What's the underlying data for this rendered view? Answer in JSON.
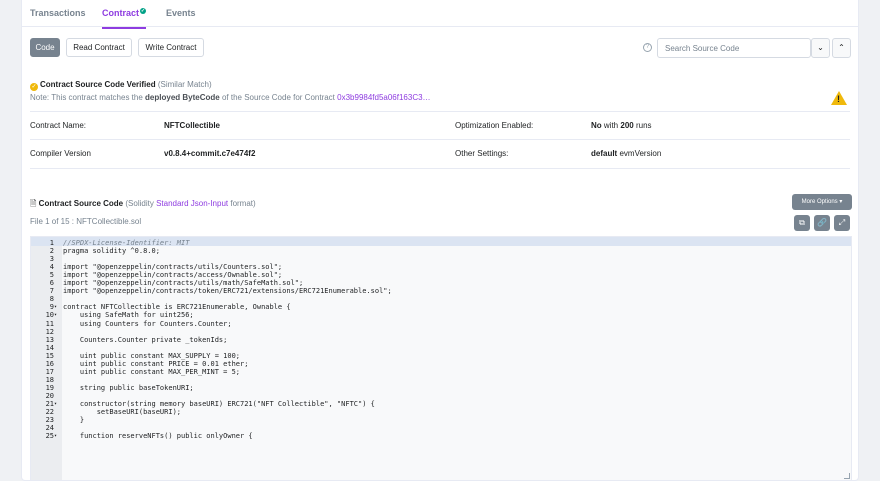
{
  "tabs": [
    {
      "label": "Transactions"
    },
    {
      "label": "Contract"
    },
    {
      "label": "Events"
    }
  ],
  "toolbar": {
    "code_label": "Code",
    "read_label": "Read Contract",
    "write_label": "Write Contract",
    "help_glyph": "?",
    "search_placeholder": "Search Source Code"
  },
  "verification": {
    "title": "Contract Source Code Verified",
    "match": "(Similar Match)",
    "note_prefix": "Note: This contract matches the",
    "note_bold": "deployed ByteCode",
    "note_mid": "of the Source Code for Contract",
    "address": "0x3b9984fd5a06f163C3…"
  },
  "details": {
    "contract_name_label": "Contract Name:",
    "contract_name": "NFTCollectible",
    "compiler_label": "Compiler Version",
    "compiler": "v0.8.4+commit.c7e474f2",
    "optimization_label": "Optimization Enabled:",
    "optimization_bold": "No",
    "optimization_mid": "with",
    "optimization_runs": "200",
    "optimization_suffix": "runs",
    "other_label": "Other Settings:",
    "other_bold": "default",
    "other_rest": "evmVersion"
  },
  "source": {
    "title": "Contract Source Code",
    "fmt_prefix": "(Solidity",
    "fmt_link": "Standard Json-Input",
    "fmt_suffix": "format)",
    "more_options": "More Options",
    "file_label": "File 1 of 15 : NFTCollectible.sol"
  },
  "code_lines": [
    {
      "n": "1",
      "fold": "",
      "t": "//SPDX-License-Identifier: MIT"
    },
    {
      "n": "2",
      "fold": "",
      "t": "pragma solidity ^0.8.0;"
    },
    {
      "n": "3",
      "fold": "",
      "t": ""
    },
    {
      "n": "4",
      "fold": "",
      "t": "import \"@openzeppelin/contracts/utils/Counters.sol\";"
    },
    {
      "n": "5",
      "fold": "",
      "t": "import \"@openzeppelin/contracts/access/Ownable.sol\";"
    },
    {
      "n": "6",
      "fold": "",
      "t": "import \"@openzeppelin/contracts/utils/math/SafeMath.sol\";"
    },
    {
      "n": "7",
      "fold": "",
      "t": "import \"@openzeppelin/contracts/token/ERC721/extensions/ERC721Enumerable.sol\";"
    },
    {
      "n": "8",
      "fold": "",
      "t": ""
    },
    {
      "n": "9",
      "fold": "▾",
      "t": "contract NFTCollectible is ERC721Enumerable, Ownable {"
    },
    {
      "n": "10",
      "fold": "▾",
      "t": "    using SafeMath for uint256;"
    },
    {
      "n": "11",
      "fold": "",
      "t": "    using Counters for Counters.Counter;"
    },
    {
      "n": "12",
      "fold": "",
      "t": ""
    },
    {
      "n": "13",
      "fold": "",
      "t": "    Counters.Counter private _tokenIds;"
    },
    {
      "n": "14",
      "fold": "",
      "t": ""
    },
    {
      "n": "15",
      "fold": "",
      "t": "    uint public constant MAX_SUPPLY = 100;"
    },
    {
      "n": "16",
      "fold": "",
      "t": "    uint public constant PRICE = 0.01 ether;"
    },
    {
      "n": "17",
      "fold": "",
      "t": "    uint public constant MAX_PER_MINT = 5;"
    },
    {
      "n": "18",
      "fold": "",
      "t": ""
    },
    {
      "n": "19",
      "fold": "",
      "t": "    string public baseTokenURI;"
    },
    {
      "n": "20",
      "fold": "",
      "t": ""
    },
    {
      "n": "21",
      "fold": "▾",
      "t": "    constructor(string memory baseURI) ERC721(\"NFT Collectible\", \"NFTC\") {"
    },
    {
      "n": "22",
      "fold": "",
      "t": "        setBaseURI(baseURI);"
    },
    {
      "n": "23",
      "fold": "",
      "t": "    }"
    },
    {
      "n": "24",
      "fold": "",
      "t": ""
    },
    {
      "n": "25",
      "fold": "▾",
      "t": "    function reserveNFTs() public onlyOwner {"
    }
  ],
  "colors": {
    "accent": "#8e3ce0",
    "verified_check": "#f0b90b",
    "warning": "#f0b90b",
    "button_gray": "#77838f"
  },
  "icons": {
    "contract_verified": "check-circle-icon",
    "help": "question-circle-icon",
    "warning": "warning-triangle-icon",
    "file": "file-icon",
    "copy": "copy-icon",
    "link": "link-icon",
    "fullscreen": "expand-icon"
  }
}
